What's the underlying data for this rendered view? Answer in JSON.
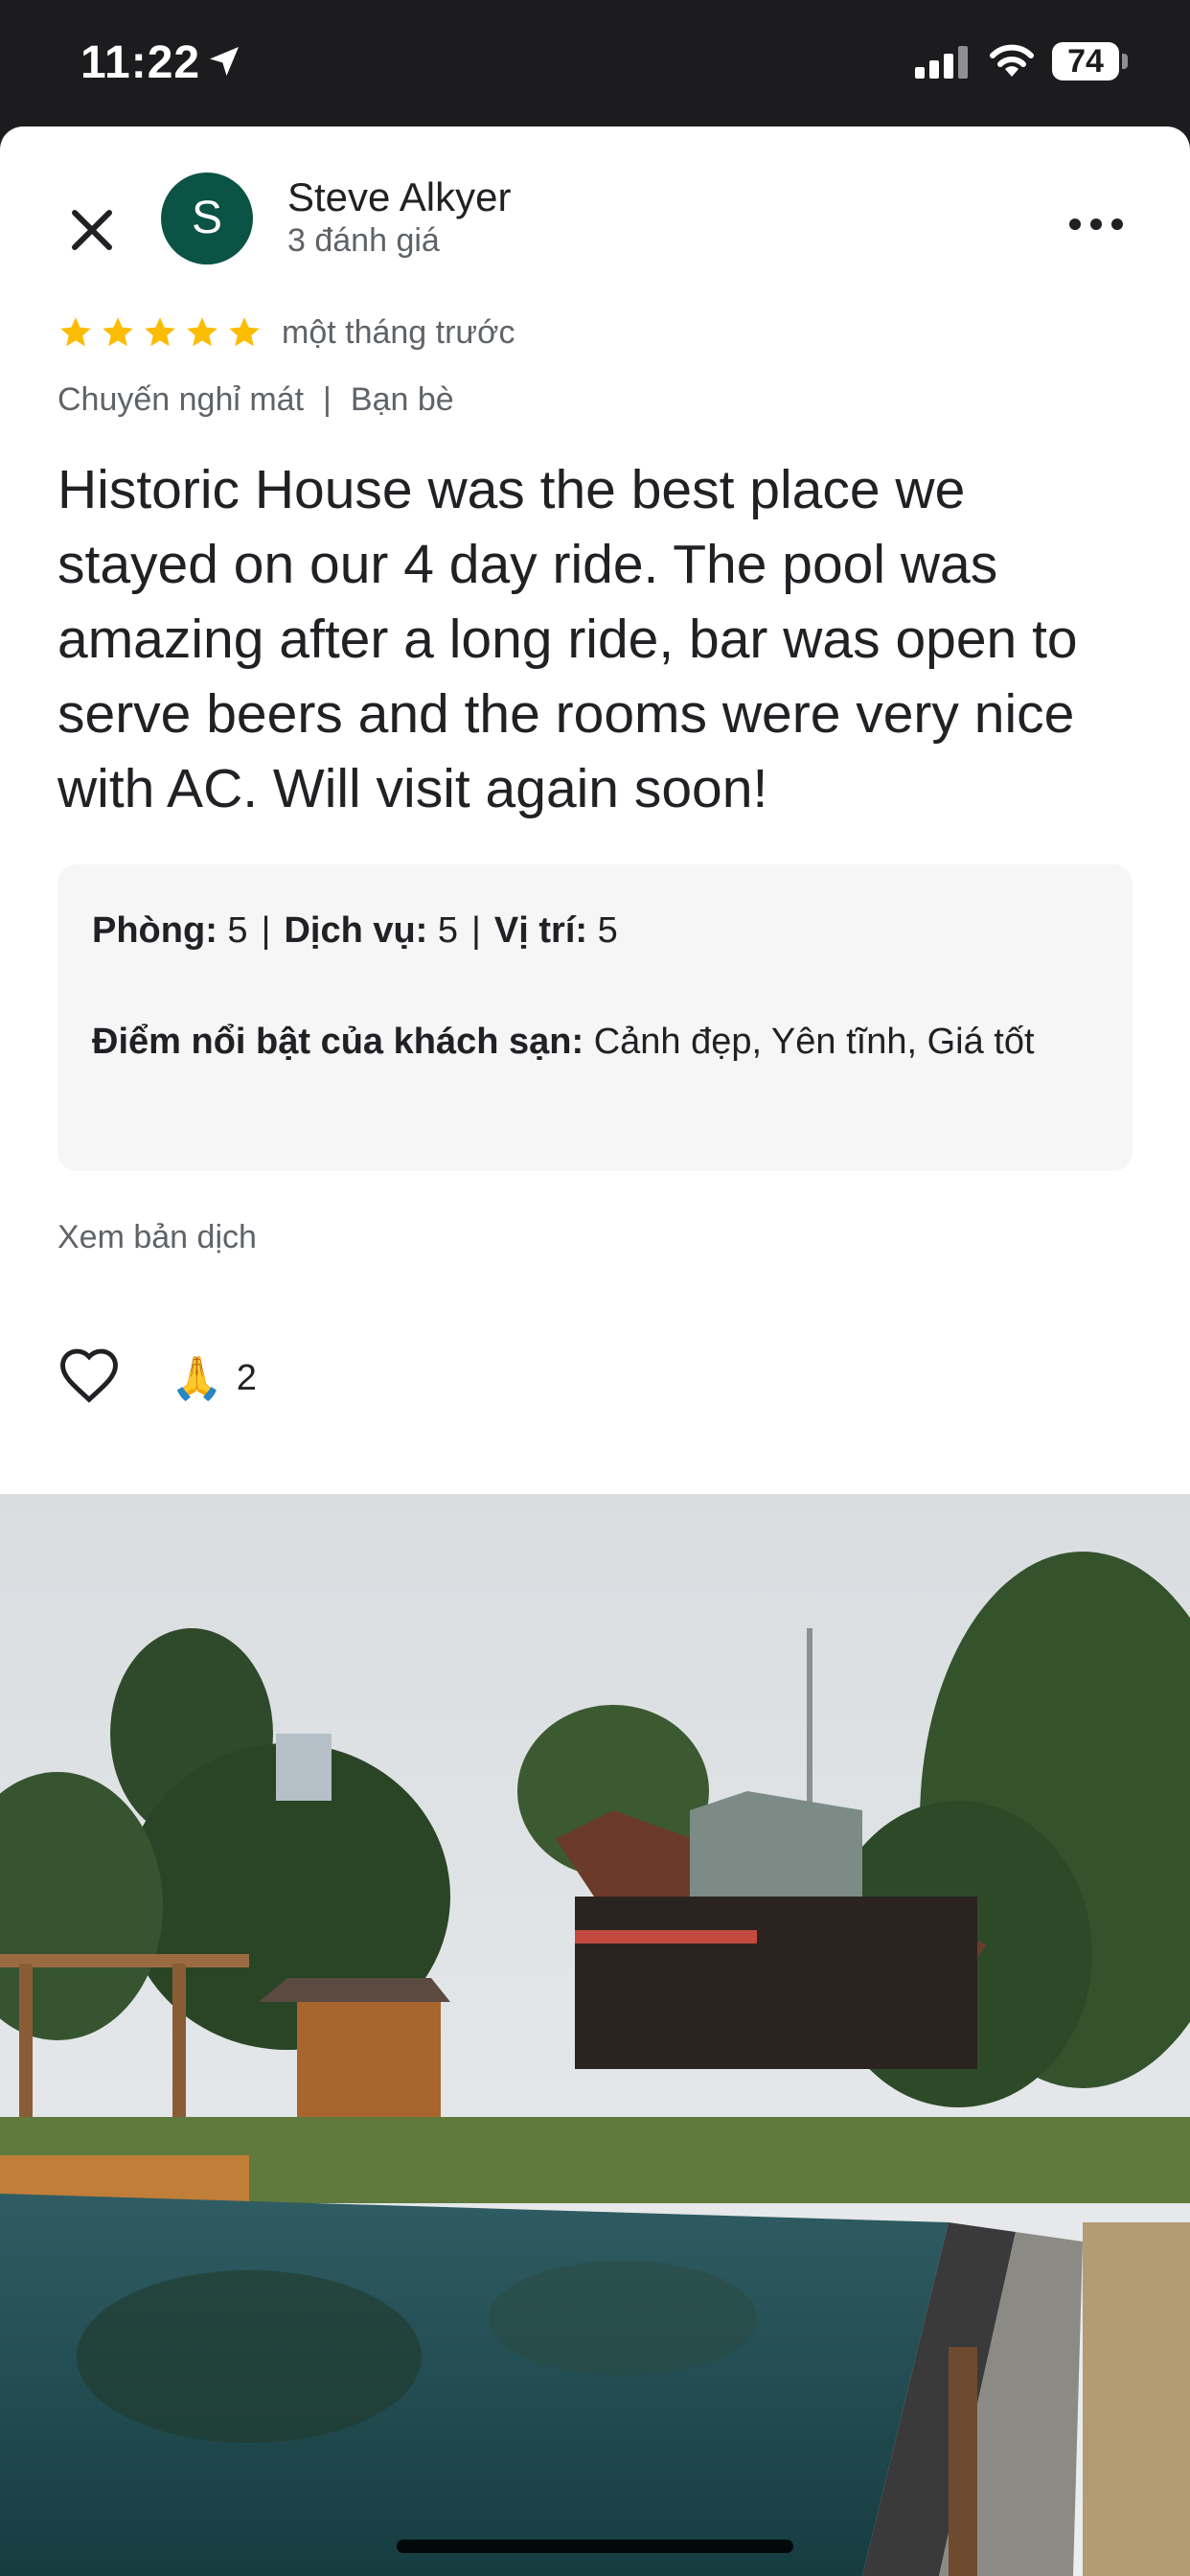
{
  "status_bar": {
    "time": "11:22",
    "battery": "74",
    "icons": [
      "location-arrow-icon",
      "signal-icon",
      "wifi-icon",
      "battery-icon"
    ]
  },
  "reviewer": {
    "avatar_letter": "S",
    "avatar_color": "#0b5345",
    "name": "Steve Alkyer",
    "review_count": "3 đánh giá"
  },
  "review": {
    "stars": 5,
    "star_color": "#fbbc04",
    "time_ago": "một tháng trước",
    "trip_type": "Chuyến nghỉ mát",
    "companions": "Bạn bè",
    "text": "Historic House was the best place we stayed on our 4 day ride.  The pool was amazing after a long ride, bar was open to serve beers and the rooms were very nice with AC.  Will visit again soon!"
  },
  "details": {
    "room_label": "Phòng:",
    "room_value": "5",
    "service_label": "Dịch vụ:",
    "service_value": "5",
    "location_label": "Vị trí:",
    "location_value": "5",
    "highlights_label": "Điểm nổi bật của khách sạn:",
    "highlights_value": "Cảnh đẹp, Yên tĩnh, Giá tốt"
  },
  "actions": {
    "translate": "Xem bản dịch",
    "reaction_emoji": "🙏",
    "reaction_count": "2"
  }
}
